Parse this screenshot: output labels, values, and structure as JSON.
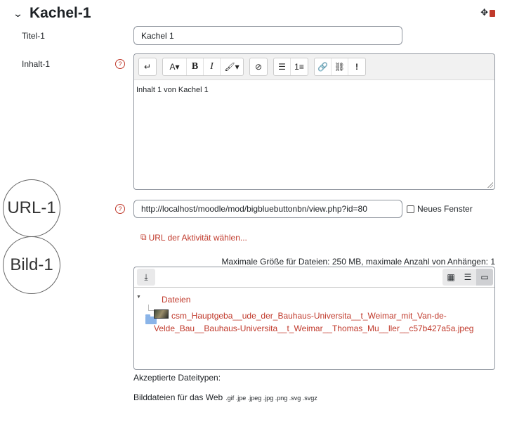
{
  "section": {
    "title": "Kachel-1"
  },
  "fields": {
    "title_label": "Titel-1",
    "title_value": "Kachel 1",
    "content_label": "Inhalt-1",
    "content_text": "Inhalt 1 von Kachel 1",
    "url_value": "http://localhost/moodle/mod/bigbluebuttonbn/view.php?id=80",
    "new_window_label": "Neues Fenster",
    "choose_activity_link": "URL der Aktivität wählen..."
  },
  "annotations": {
    "url": "URL-1",
    "image": "Bild-1"
  },
  "toolbar": {
    "buttons": [
      "↵",
      "A▾",
      "B",
      "I",
      "🖌▾",
      "⊘",
      "☰",
      "1≡",
      "🔗",
      "⛓",
      "!"
    ]
  },
  "filemanager": {
    "limits": "Maximale Größe für Dateien: 250 MB, maximale Anzahl von Anhängen: 1",
    "folder_name": "Dateien",
    "file_name_line1": "csm_Hauptgeba__ude_der_Bauhaus-Universita__t_Weimar_mit_Van-de-",
    "file_name_line2": "Velde_Bau__Bauhaus-Universita__t_Weimar__Thomas_Mu__ller__c57b427a5a.jpeg"
  },
  "accepted": {
    "label": "Akzeptierte Dateitypen:",
    "type_name": "Bilddateien für das Web",
    "extensions": ".gif .jpe .jpeg .jpg .png .svg .svgz"
  },
  "colors": {
    "accent": "#c0392b",
    "border": "#8f959e"
  },
  "icons": [
    "chevron-down-icon",
    "move-icon",
    "trash-icon",
    "help-icon",
    "external-link-icon",
    "download-icon",
    "grid-view-icon",
    "list-view-icon",
    "folder-view-icon",
    "folder-icon",
    "image-thumbnail-icon"
  ]
}
